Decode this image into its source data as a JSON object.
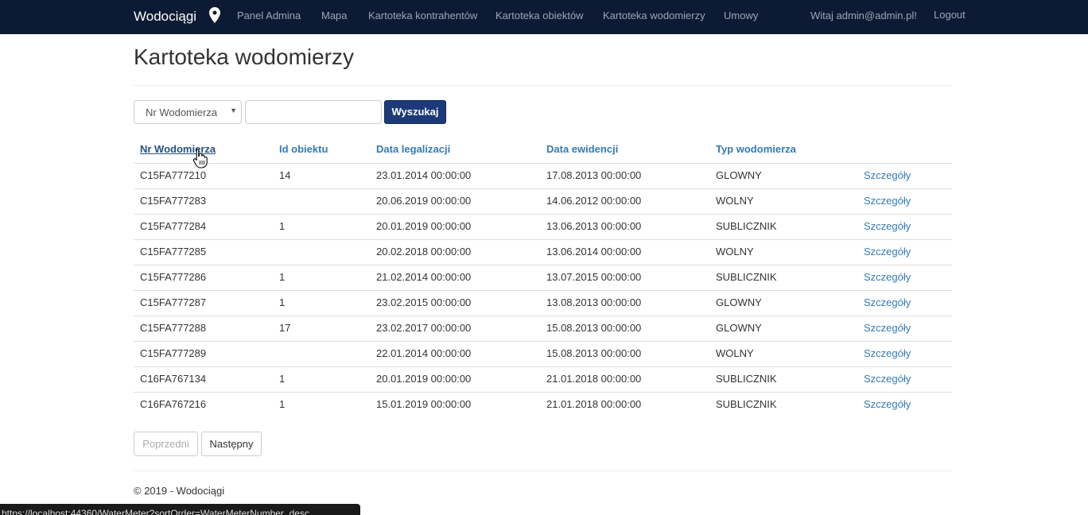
{
  "navbar": {
    "brand": "Wodociągi",
    "pin_icon": "map-marker-icon",
    "links": [
      "Panel Admina",
      "Mapa",
      "Kartoteka kontrahentów",
      "Kartoteka obiektów",
      "Kartoteka wodomierzy",
      "Umowy"
    ],
    "welcome": "Witaj admin@admin.pl!",
    "logout": "Logout",
    "background_color": "#0c1a33"
  },
  "page": {
    "title": "Kartoteka wodomierzy"
  },
  "search": {
    "field_selected": "Nr Wodomierza",
    "input_value": "",
    "button_label": "Wyszukaj",
    "button_color": "#1c3a78"
  },
  "table": {
    "headers": [
      "Nr Wodomierza",
      "Id obiektu",
      "Data legalizacji",
      "Data ewidencji",
      "Typ wodomierza"
    ],
    "details_label": "Szczegóły",
    "rows": [
      [
        "C15FA777210",
        "14",
        "23.01.2014 00:00:00",
        "17.08.2013 00:00:00",
        "GLOWNY"
      ],
      [
        "C15FA777283",
        "",
        "20.06.2019 00:00:00",
        "14.06.2012 00:00:00",
        "WOLNY"
      ],
      [
        "C15FA777284",
        "1",
        "20.01.2019 00:00:00",
        "13.06.2013 00:00:00",
        "SUBLICZNIK"
      ],
      [
        "C15FA777285",
        "",
        "20.02.2018 00:00:00",
        "13.06.2014 00:00:00",
        "WOLNY"
      ],
      [
        "C15FA777286",
        "1",
        "21.02.2014 00:00:00",
        "13.07.2015 00:00:00",
        "SUBLICZNIK"
      ],
      [
        "C15FA777287",
        "1",
        "23.02.2015 00:00:00",
        "13.08.2013 00:00:00",
        "GLOWNY"
      ],
      [
        "C15FA777288",
        "17",
        "23.02.2017 00:00:00",
        "15.08.2013 00:00:00",
        "GLOWNY"
      ],
      [
        "C15FA777289",
        "",
        "22.01.2014 00:00:00",
        "15.08.2013 00:00:00",
        "WOLNY"
      ],
      [
        "C16FA767134",
        "1",
        "20.01.2019 00:00:00",
        "21.01.2018 00:00:00",
        "SUBLICZNIK"
      ],
      [
        "C16FA767216",
        "1",
        "15.01.2019 00:00:00",
        "21.01.2018 00:00:00",
        "SUBLICZNIK"
      ]
    ]
  },
  "pager": {
    "prev": "Poprzedni",
    "next": "Następny"
  },
  "footer": {
    "text": "© 2019 - Wodociągi"
  },
  "status_bar": {
    "url": "https://localhost:44360/WaterMeter?sortOrder=WaterMeterNumber_desc"
  },
  "cursor": {
    "icon": "hand-pointer-icon"
  },
  "colors": {
    "link": "#337ab7",
    "text": "#333333"
  }
}
